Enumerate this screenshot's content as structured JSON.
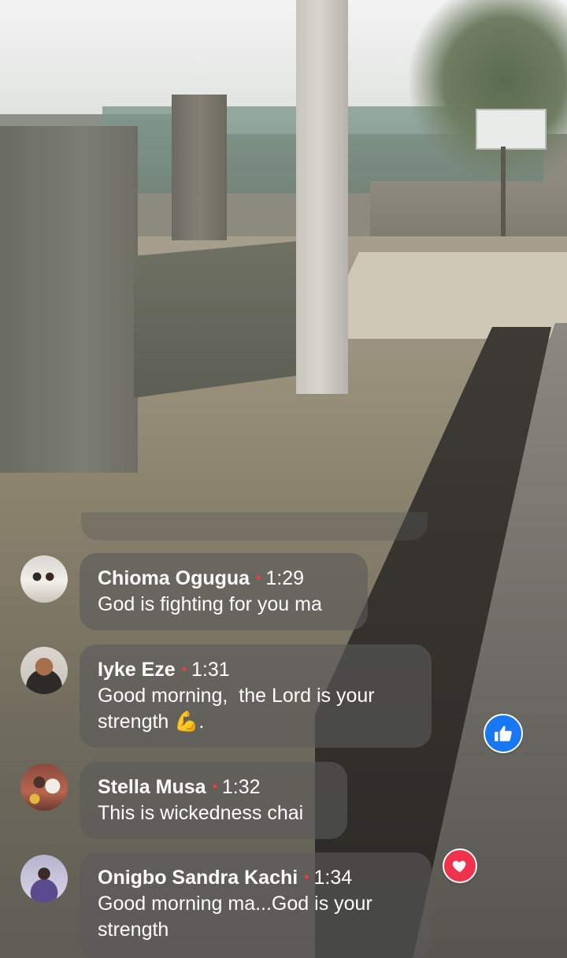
{
  "comments": [
    {
      "author": "Chioma Ogugua",
      "separator": "•",
      "time": "1:29",
      "message": "God is fighting for you ma",
      "avatar": "avatar-chioma"
    },
    {
      "author": "Iyke Eze",
      "separator": "•",
      "time": "1:31",
      "message": "Good morning,  the Lord is your strength 💪.",
      "avatar": "avatar-iyke"
    },
    {
      "author": "Stella Musa",
      "separator": "•",
      "time": "1:32",
      "message": "This is wickedness chai",
      "avatar": "avatar-stella"
    },
    {
      "author": "Onigbo Sandra Kachi",
      "separator": "•",
      "time": "1:34",
      "message": "Good morning ma...God is your strength",
      "avatar": "avatar-onigbo"
    }
  ],
  "reactions": {
    "like": {
      "icon": "thumbs-up-icon",
      "color": "#1877f2"
    },
    "love": {
      "icon": "heart-icon",
      "color": "#f0324d"
    }
  },
  "colors": {
    "bubble_bg": "rgba(90,90,90,0.62)",
    "separator": "#f03e3e",
    "text": "#ffffff"
  }
}
